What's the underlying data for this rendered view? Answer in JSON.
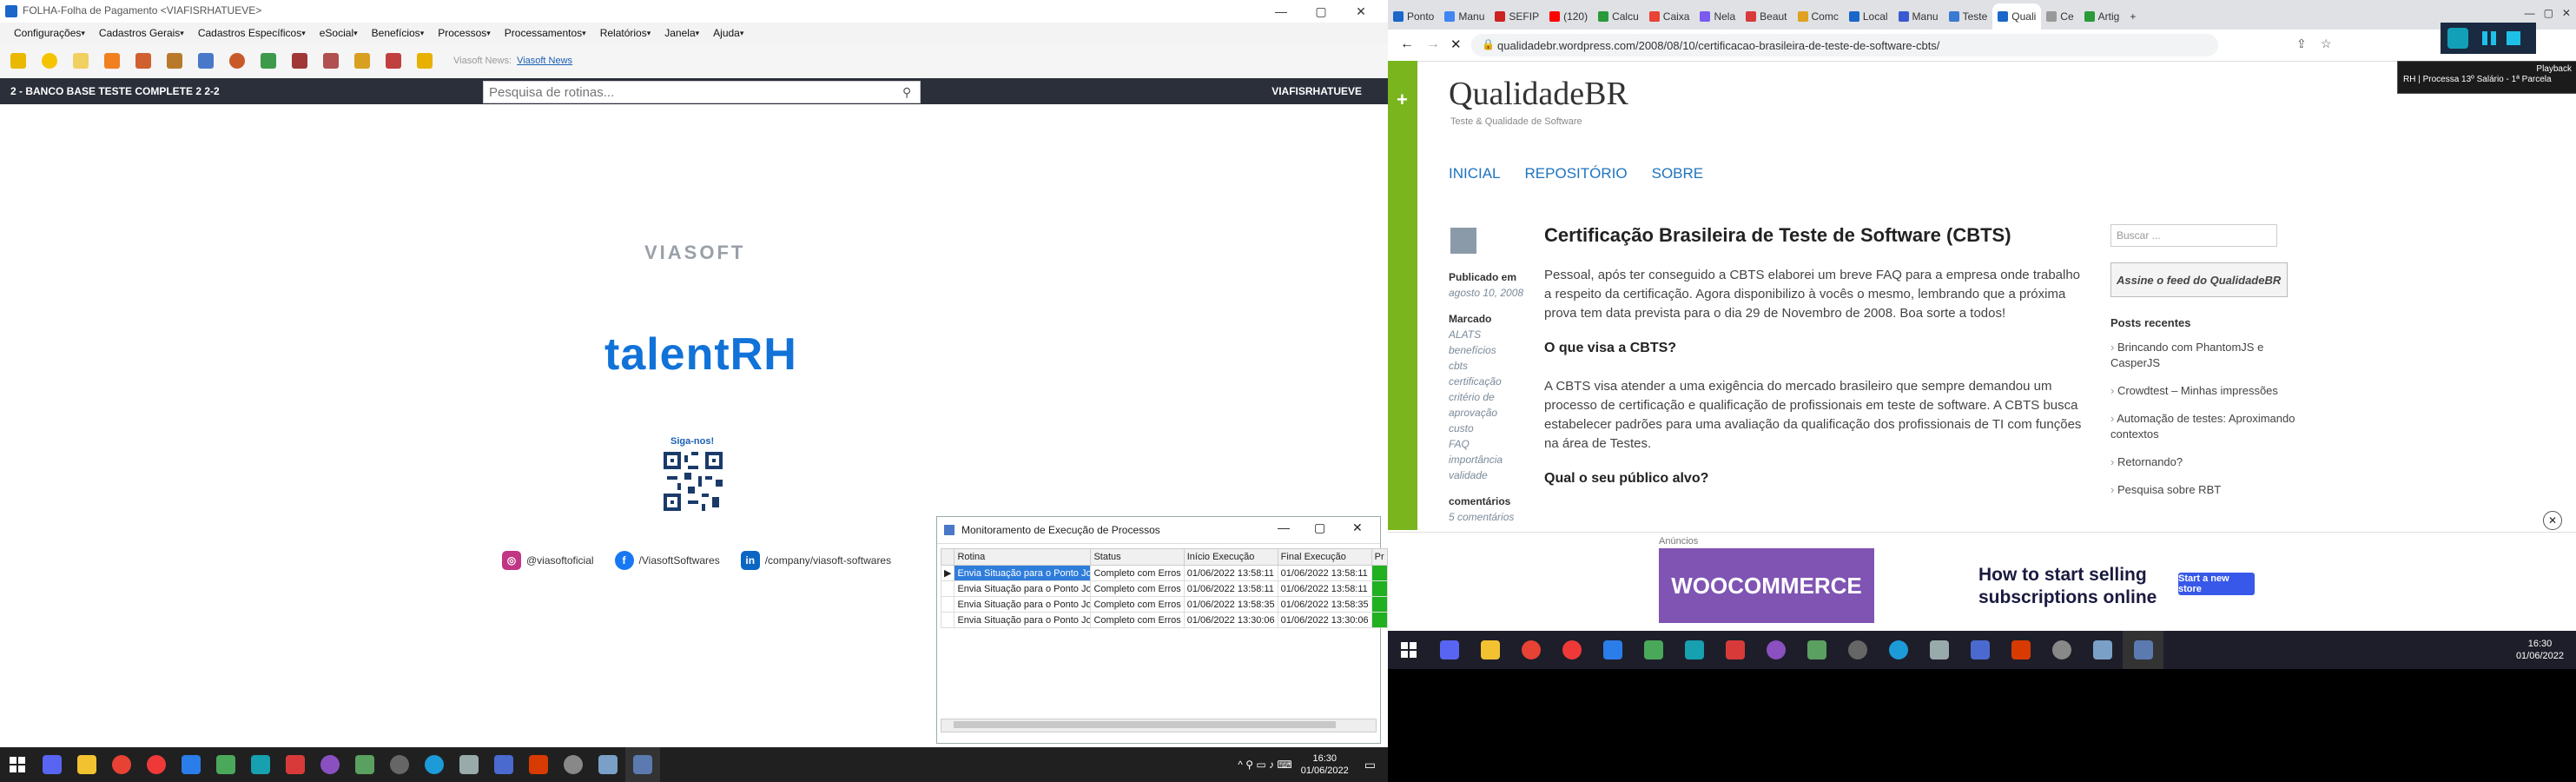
{
  "left_app": {
    "window_title": "FOLHA-Folha de Pagamento <VIAFISRHATUEVE>",
    "window_controls": {
      "minimize": "—",
      "maximize": "▢",
      "close": "✕"
    },
    "menu": [
      "Configurações",
      "Cadastros Gerais",
      "Cadastros Específicos",
      "eSocial",
      "Benefícios",
      "Processos",
      "Processamentos",
      "Relatórios",
      "Janela",
      "Ajuda"
    ],
    "news_label": "Viasoft News:",
    "news_link": "Viasoft News",
    "database": "2 - BANCO BASE TESTE COMPLETE 2 2-2",
    "search_placeholder": "Pesquisa de rotinas...",
    "user": "VIAFISRHATUEVE",
    "brand": "VIASOFT",
    "product": "talentRH",
    "follow": "Siga-nos!",
    "socials": [
      {
        "icon": "instagram-icon",
        "text": "@viasoftoficial",
        "color": "#c13584"
      },
      {
        "icon": "facebook-icon",
        "text": "/ViasoftSoftwares",
        "color": "#1877f2"
      },
      {
        "icon": "linkedin-icon",
        "text": "/company/viasoft-softwares",
        "color": "#0a66c2"
      }
    ]
  },
  "monitor": {
    "title": "Monitoramento de Execução de Processos",
    "columns": [
      "Rotina",
      "Status",
      "Início Execução",
      "Final Execução",
      "Pr"
    ],
    "rows": [
      {
        "rotina": "Envia Situação para o Ponto Job",
        "status": "Completo com Erros",
        "inicio": "01/06/2022 13:58:11",
        "final": "01/06/2022 13:58:11"
      },
      {
        "rotina": "Envia Situação para o Ponto Job",
        "status": "Completo com Erros",
        "inicio": "01/06/2022 13:58:11",
        "final": "01/06/2022 13:58:11"
      },
      {
        "rotina": "Envia Situação para o Ponto Job",
        "status": "Completo com Erros",
        "inicio": "01/06/2022 13:58:35",
        "final": "01/06/2022 13:58:35"
      },
      {
        "rotina": "Envia Situação para o Ponto Job",
        "status": "Completo com Erros",
        "inicio": "01/06/2022 13:30:06",
        "final": "01/06/2022 13:30:06"
      }
    ]
  },
  "left_taskbar": {
    "time": "16:30",
    "date": "01/06/2022"
  },
  "browser": {
    "tabs": [
      "Ponto",
      "Manu",
      "SEFIP",
      "(120)",
      "Calcu",
      "Caixa",
      "Nela",
      "Beaut",
      "Comc",
      "Local",
      "Manu",
      "Teste",
      "Quali",
      "Ce",
      "Artig"
    ],
    "url": "qualidadebr.wordpress.com/2008/08/10/certificacao-brasileira-de-teste-de-software-cbts/",
    "tooltip_line1": "Playback",
    "tooltip_line2": "RH | Processa 13º Salário - 1ª Parcela"
  },
  "blog": {
    "title": "QualidadeBR",
    "subtitle": "Teste & Qualidade de Software",
    "nav": [
      "INICIAL",
      "REPOSITÓRIO",
      "SOBRE"
    ],
    "published_label": "Publicado em",
    "published_date": "agosto 10, 2008",
    "tags_label": "Marcado",
    "tags": [
      "ALATS",
      "benefícios",
      "cbts",
      "certificação",
      "critério de",
      "aprovação",
      "custo",
      "FAQ",
      "importância",
      "validade"
    ],
    "comments_label": "comentários",
    "comments_count": "5 comentários",
    "post_title": "Certificação Brasileira de Teste de Software (CBTS)",
    "p1": "Pessoal, após ter conseguido a CBTS elaborei um breve FAQ para a empresa onde trabalho a respeito da certificação. Agora disponibilizo à vocês o mesmo, lembrando que a próxima prova tem data prevista para o dia 29 de Novembro de 2008. Boa sorte a todos!",
    "h1": "O que visa a CBTS?",
    "p2": "A CBTS visa atender a uma exigência do mercado brasileiro que sempre demandou um processo de certificação e qualificação de profissionais em teste de software. A CBTS busca estabelecer padrões para uma avaliação da qualificação dos profissionais de TI com funções na área de Testes.",
    "h2": "Qual o seu público alvo?",
    "search_placeholder": "Buscar ...",
    "feed_label": "Assine o feed do QualidadeBR",
    "recent_title": "Posts recentes",
    "recent": [
      "Brincando com PhantomJS e CasperJS",
      "Crowdtest – Minhas impressões",
      "Automação de testes: Aproximando contextos",
      "Retornando?",
      "Pesquisa sobre RBT"
    ]
  },
  "ad": {
    "label": "Anúncios",
    "brand": "WOOCOMMERCE",
    "headline": "How to start selling subscriptions online",
    "button": "Start a new store"
  },
  "right_taskbar": {
    "time": "16:30",
    "date": "01/06/2022"
  }
}
